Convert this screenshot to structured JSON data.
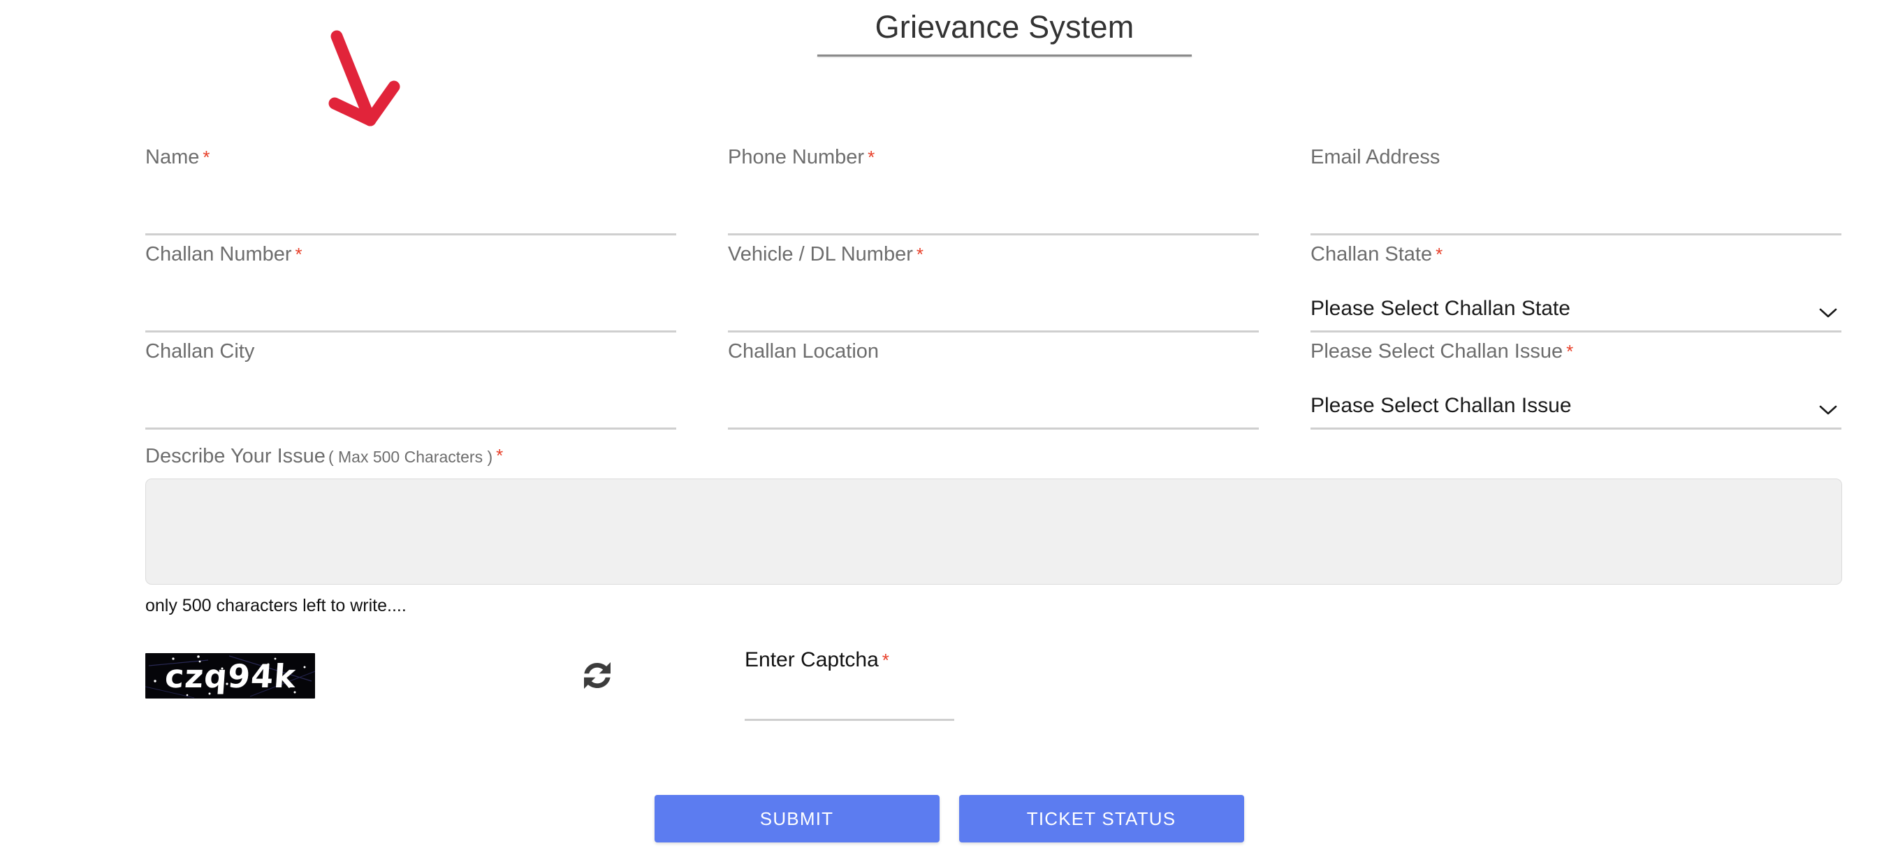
{
  "header": {
    "title": "Grievance System"
  },
  "annotation": {
    "arrow_color": "#e1243a",
    "arrow_icon": "arrow-down-right-icon"
  },
  "theme": {
    "button_blue": "#5c7cf0",
    "required_red": "#e8402a",
    "label_grey": "#6d6d6d",
    "underline_grey": "#cfcfcf",
    "textarea_bg": "#f0f0f0"
  },
  "form": {
    "rows": [
      [
        {
          "label": "Name",
          "required": true,
          "type": "text",
          "value": ""
        },
        {
          "label": "Phone Number",
          "required": true,
          "type": "text",
          "value": ""
        },
        {
          "label": "Email Address",
          "required": false,
          "type": "text",
          "value": ""
        }
      ],
      [
        {
          "label": "Challan Number",
          "required": true,
          "type": "text",
          "value": ""
        },
        {
          "label": "Vehicle / DL Number",
          "required": true,
          "type": "text",
          "value": ""
        },
        {
          "label": "Challan State",
          "required": true,
          "type": "select",
          "value": "Please Select Challan State"
        }
      ],
      [
        {
          "label": "Challan City",
          "required": false,
          "type": "text",
          "value": ""
        },
        {
          "label": "Challan Location",
          "required": false,
          "type": "text",
          "value": ""
        },
        {
          "label": "Please Select Challan Issue",
          "required": true,
          "type": "select",
          "value": "Please Select Challan Issue"
        }
      ]
    ]
  },
  "describe": {
    "label": "Describe Your Issue",
    "hint": "( Max 500 Characters )",
    "required": true,
    "value": "",
    "counter": "only 500 characters left to write...."
  },
  "captcha": {
    "image_text": "czq94k",
    "refresh_icon": "refresh-icon",
    "input_label": "Enter Captcha",
    "input_required": true,
    "input_value": ""
  },
  "actions": {
    "submit_label": "SUBMIT",
    "ticket_status_label": "TICKET STATUS"
  }
}
